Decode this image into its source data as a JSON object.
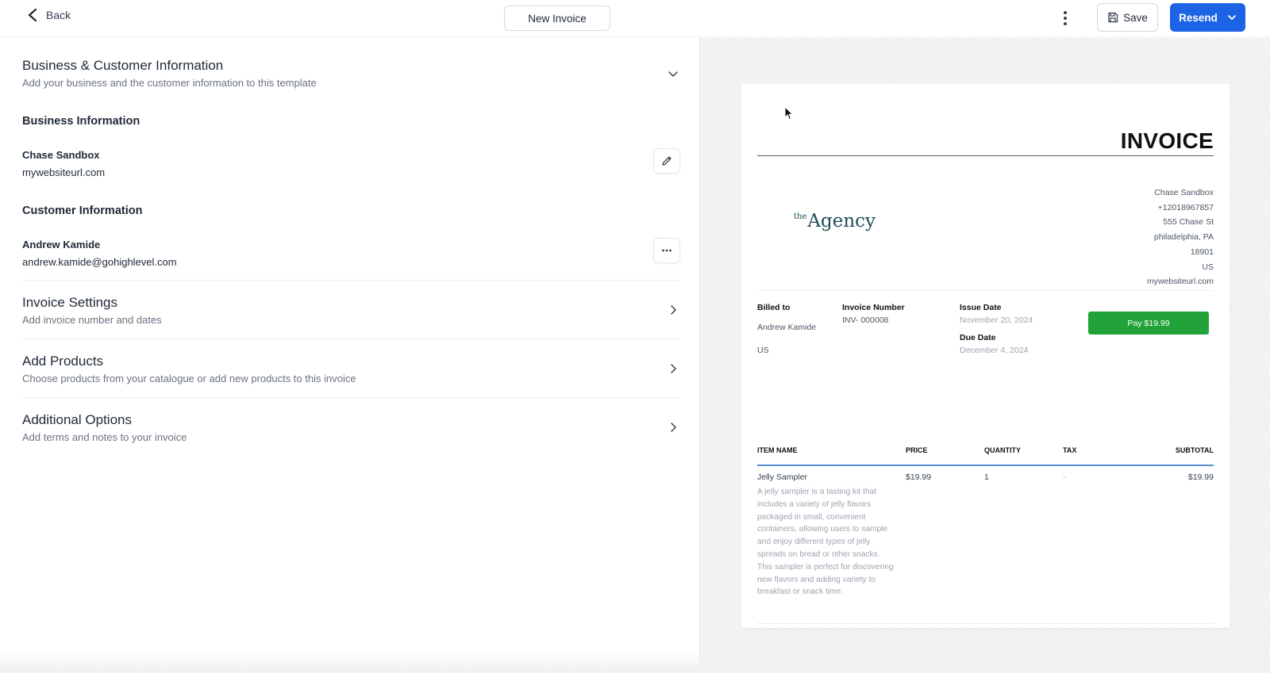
{
  "topbar": {
    "back_label": "Back",
    "title": "New Invoice",
    "save_label": "Save",
    "resend_label": "Resend"
  },
  "sections": {
    "business_customer": {
      "title": "Business & Customer Information",
      "subtitle": "Add your business and the customer information to this template"
    },
    "business_info": {
      "heading": "Business Information",
      "name": "Chase Sandbox",
      "website": "mywebsiteurl.com"
    },
    "customer_info": {
      "heading": "Customer Information",
      "name": "Andrew Kamide",
      "email": "andrew.kamide@gohighlevel.com"
    },
    "invoice_settings": {
      "title": "Invoice Settings",
      "subtitle": "Add invoice number and dates"
    },
    "add_products": {
      "title": "Add Products",
      "subtitle": "Choose products from your catalogue or add new products to this invoice"
    },
    "additional_options": {
      "title": "Additional Options",
      "subtitle": "Add terms and notes to your invoice"
    }
  },
  "preview": {
    "heading": "INVOICE",
    "logo_small": "the",
    "logo_main": "Agency",
    "business_lines": [
      "Chase Sandbox",
      "+12018967857",
      "555 Chase St",
      "philadelphia, PA",
      "18901",
      "US",
      "mywebsiteurl.com"
    ],
    "billed_to_label": "Billed to",
    "billed_to_name": "Andrew Kamide",
    "billed_to_country": "US",
    "invoice_number_label": "Invoice Number",
    "invoice_number": "INV- 000008",
    "issue_date_label": "Issue Date",
    "issue_date": "November 20, 2024",
    "due_date_label": "Due Date",
    "due_date": "December 4, 2024",
    "pay_button": "Pay $19.99",
    "table": {
      "headers": [
        "ITEM NAME",
        "PRICE",
        "QUANTITY",
        "TAX",
        "SUBTOTAL"
      ],
      "rows": [
        {
          "name": "Jelly Sampler",
          "price": "$19.99",
          "quantity": "1",
          "tax": "-",
          "subtotal": "$19.99",
          "description": "A jelly sampler is a tasting kit that includes a variety of jelly flavors packaged in small, convenient containers, allowing users to sample and enjoy different types of jelly spreads on bread or other snacks. This sampler is perfect for discovering new flavors and adding variety to breakfast or snack time."
        }
      ]
    }
  },
  "colors": {
    "primary": "#1d63e6",
    "pay_green": "#22a33a",
    "logo_teal": "#1b4d55",
    "table_rule": "#5b8fd4"
  },
  "icons": {
    "back": "chevron-left-icon",
    "more": "vertical-dots-icon",
    "save": "floppy-disk-icon",
    "resend_menu": "chevron-down-icon",
    "edit": "pencil-icon",
    "options": "horizontal-dots-icon"
  }
}
